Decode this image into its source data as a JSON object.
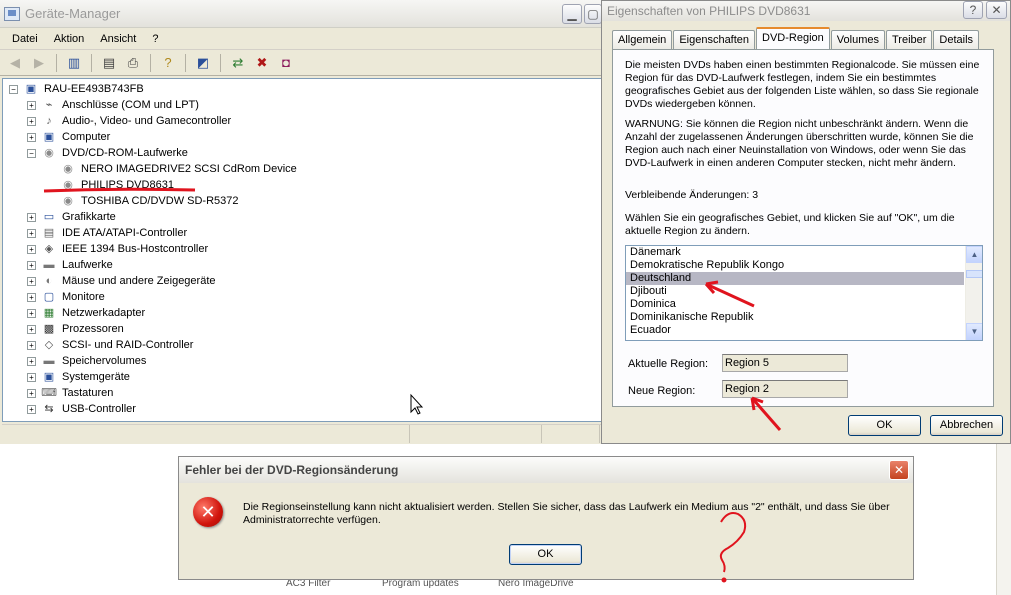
{
  "device_manager": {
    "title": "Geräte-Manager",
    "menu": [
      "Datei",
      "Aktion",
      "Ansicht",
      "?"
    ],
    "root": "RAU-EE493B743FB",
    "tree": [
      {
        "label": "Anschlüsse (COM und LPT)",
        "expander": "+",
        "icon": "⌁",
        "depth": 1
      },
      {
        "label": "Audio-, Video- und Gamecontroller",
        "expander": "+",
        "icon": "♪",
        "depth": 1
      },
      {
        "label": "Computer",
        "expander": "+",
        "icon": "▣",
        "depth": 1
      },
      {
        "label": "DVD/CD-ROM-Laufwerke",
        "expander": "−",
        "icon": "◉",
        "depth": 1
      },
      {
        "label": "NERO IMAGEDRIVE2 SCSI CdRom Device",
        "expander": "",
        "icon": "◉",
        "depth": 2
      },
      {
        "label": "PHILIPS DVD8631",
        "expander": "",
        "icon": "◉",
        "depth": 2
      },
      {
        "label": "TOSHIBA CD/DVDW SD-R5372",
        "expander": "",
        "icon": "◉",
        "depth": 2
      },
      {
        "label": "Grafikkarte",
        "expander": "+",
        "icon": "▭",
        "depth": 1
      },
      {
        "label": "IDE ATA/ATAPI-Controller",
        "expander": "+",
        "icon": "▤",
        "depth": 1
      },
      {
        "label": "IEEE 1394 Bus-Hostcontroller",
        "expander": "+",
        "icon": "◈",
        "depth": 1
      },
      {
        "label": "Laufwerke",
        "expander": "+",
        "icon": "▬",
        "depth": 1
      },
      {
        "label": "Mäuse und andere Zeigegeräte",
        "expander": "+",
        "icon": "◐",
        "depth": 1
      },
      {
        "label": "Monitore",
        "expander": "+",
        "icon": "▢",
        "depth": 1
      },
      {
        "label": "Netzwerkadapter",
        "expander": "+",
        "icon": "▦",
        "depth": 1
      },
      {
        "label": "Prozessoren",
        "expander": "+",
        "icon": "▩",
        "depth": 1
      },
      {
        "label": "SCSI- und RAID-Controller",
        "expander": "+",
        "icon": "◇",
        "depth": 1
      },
      {
        "label": "Speichervolumes",
        "expander": "+",
        "icon": "▬",
        "depth": 1
      },
      {
        "label": "Systemgeräte",
        "expander": "+",
        "icon": "▣",
        "depth": 1
      },
      {
        "label": "Tastaturen",
        "expander": "+",
        "icon": "⌨",
        "depth": 1
      },
      {
        "label": "USB-Controller",
        "expander": "+",
        "icon": "⇆",
        "depth": 1
      }
    ]
  },
  "properties": {
    "title": "Eigenschaften von PHILIPS DVD8631",
    "tabs": [
      "Allgemein",
      "Eigenschaften",
      "DVD-Region",
      "Volumes",
      "Treiber",
      "Details"
    ],
    "active_tab": "DVD-Region",
    "intro": "Die meisten DVDs haben einen bestimmten Regionalcode. Sie müssen eine Region für das DVD-Laufwerk festlegen, indem Sie ein bestimmtes geografisches Gebiet aus der folgenden Liste wählen, so dass Sie regionale DVDs wiedergeben können.",
    "warning": "WARNUNG: Sie können die Region nicht unbeschränkt ändern. Wenn die Anzahl der zugelassenen Änderungen überschritten wurde, können Sie die Region auch nach einer Neuinstallation von Windows, oder wenn Sie das DVD-Laufwerk in einen anderen Computer stecken, nicht mehr ändern.",
    "remaining": "Verbleibende Änderungen: 3",
    "instruction": "Wählen Sie ein geografisches Gebiet, und klicken Sie auf \"OK\", um die aktuelle Region zu ändern.",
    "countries": [
      "Dänemark",
      "Demokratische Republik Kongo",
      "Deutschland",
      "Djibouti",
      "Dominica",
      "Dominikanische Republik",
      "Ecuador"
    ],
    "selected_country": "Deutschland",
    "current_region_label": "Aktuelle Region:",
    "current_region": "Region 5",
    "new_region_label": "Neue Region:",
    "new_region": "Region 2",
    "ok": "OK",
    "cancel": "Abbrechen"
  },
  "error_dialog": {
    "title": "Fehler bei der DVD-Regionsänderung",
    "message": "Die Regionseinstellung kann nicht aktualisiert werden. Stellen Sie sicher, dass das Laufwerk ein Medium aus \"2\" enthält, und dass Sie über Administratorrechte verfügen.",
    "ok": "OK"
  },
  "background_strip": [
    "AC3 Filter",
    "Program updates",
    "Nero ImageDrive"
  ],
  "colors": {
    "selection": "#b7b7c4",
    "annotation_red": "#e0141e",
    "tab_highlight": "#e68b2c"
  }
}
